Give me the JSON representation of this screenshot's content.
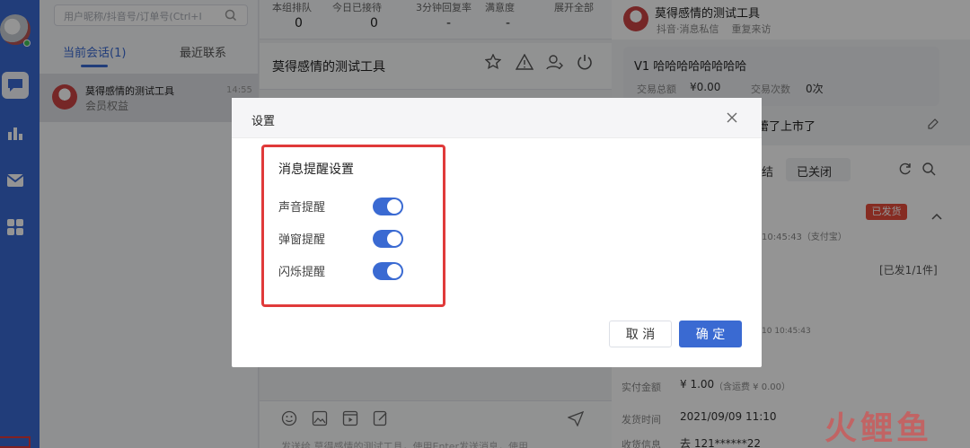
{
  "list": {
    "search_placeholder": "用户昵称/抖音号/订单号(Ctrl+I",
    "tab_current": "当前会话(1)",
    "tab_recent": "最近联系",
    "conversation": {
      "name": "莫得感情的测试工具",
      "time": "14:55",
      "preview": "会员权益"
    }
  },
  "stats": {
    "labels": [
      "本组排队",
      "今日已接待",
      "3分钟回复率",
      "满意度",
      "展开全部"
    ],
    "values": [
      "0",
      "0",
      "-",
      "-"
    ]
  },
  "chat": {
    "title": "莫得感情的测试工具",
    "input_placeholder": "发送给 莫得感情的测试工具，使用Enter发送消息，使用"
  },
  "right": {
    "profile_name": "莫得感情的测试工具",
    "profile_tags": "抖音·消息私信    重复来访",
    "vip_label": "V1 哈哈哈哈哈哈哈哈",
    "trade_total_label": "交易总额",
    "trade_total_value": "¥0.00",
    "trade_count_label": "交易次数",
    "trade_count_value": "0次",
    "note_text": "蕾了上市了",
    "order_tab_a": "结",
    "order_tab_b": "已关闭",
    "order_status": "已发货",
    "order_time1": "10:45:43（支付宝）",
    "order_shipped": "[已发1/1件]",
    "order_time2": "10 10:45:43",
    "paid_label": "实付金额",
    "paid_value": "¥ 1.00",
    "paid_note": "（含运费 ¥ 0.00）",
    "ship_time_label": "发货时间",
    "ship_time_value": "2021/09/09 11:10",
    "receiver_label": "收货信息",
    "receiver_value": "去 121******22"
  },
  "modal": {
    "title": "设置",
    "section_title": "消息提醒设置",
    "toggles": [
      {
        "label": "声音提醒",
        "on": true
      },
      {
        "label": "弹窗提醒",
        "on": true
      },
      {
        "label": "闪烁提醒",
        "on": true
      }
    ],
    "cancel_label": "取 消",
    "ok_label": "确 定"
  },
  "watermark": "火鲤鱼",
  "colors": {
    "accent": "#3a6ad2",
    "highlight_box": "#e03a3a",
    "status_red": "#e74c3c"
  }
}
